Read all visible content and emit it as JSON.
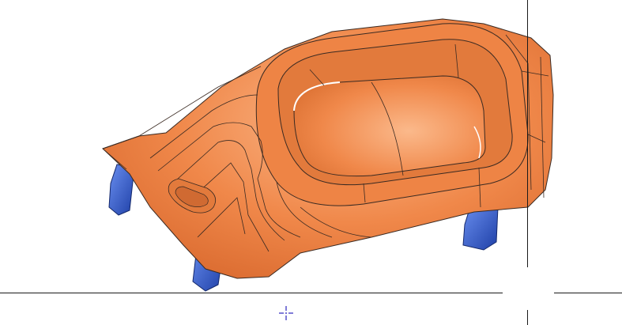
{
  "viewport": {
    "model": {
      "part_color": "#F0884A",
      "part_shade_color": "#D9692E",
      "part_highlight_color": "#FBB98B",
      "edge_color": "#3A2A22",
      "clip_color": "#2B56C8",
      "clip_highlight_color": "#6A8FF0"
    },
    "axis_color": "#1A1A1A",
    "origin_marker": {
      "icon": "origin-crosshair-icon",
      "color": "#4A44C8"
    }
  }
}
